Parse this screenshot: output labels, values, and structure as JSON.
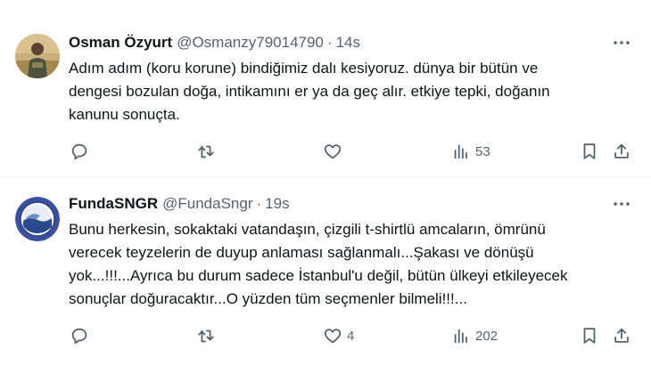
{
  "tweets": [
    {
      "author_name": "Osman Özyurt",
      "handle": "@Osmanzy79014790",
      "separator": "·",
      "time": "14s",
      "text_lines": [
        "Adım adım (koru korune) bindiğimiz dalı kesiyoruz. dünya bir bütün ve",
        "dengesi bozulan doğa, intikamını er ya da geç alır. etkiye tepki, doğanın",
        "kanunu sonuçta."
      ],
      "views": "53",
      "likes": ""
    },
    {
      "author_name": "FundaSNGR",
      "handle": "@FundaSngr",
      "separator": "·",
      "time": "19s",
      "text_lines": [
        "Bunu herkesin, sokaktaki vatandaşın, çizgili t-shirtlü amcaların, ömrünü",
        "verecek teyzelerin de duyup anlaması sağlanmalı...Şakası ve dönüşü",
        "yok...!!!...Ayrıca bu durum sadece İstanbul'u değil, bütün ülkeyi etkileyecek",
        "sonuçlar doğuracaktır...O yüzden tüm seçmenler bilmeli!!!..."
      ],
      "views": "202",
      "likes": "4"
    }
  ],
  "icons": {
    "reply": "reply-icon",
    "retweet": "retweet-icon",
    "like": "heart-icon",
    "views": "views-icon",
    "bookmark": "bookmark-icon",
    "share": "share-icon",
    "more": "more-icon"
  },
  "colors": {
    "text": "#0f1419",
    "secondary": "#536471",
    "divider": "#eff3f4",
    "background": "#ffffff"
  }
}
